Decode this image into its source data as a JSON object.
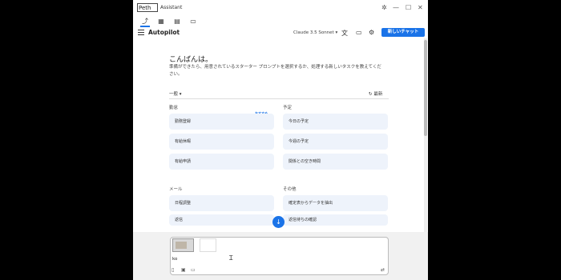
{
  "window": {
    "logo_text": "Peth",
    "app_title": "Assistant",
    "controls": {
      "settings": "✲",
      "minimize": "—",
      "maximize": "☐",
      "close": "✕"
    }
  },
  "tabs": [
    {
      "icon": "pin-icon",
      "glyph": "⤴",
      "active": true
    },
    {
      "icon": "grid-icon",
      "glyph": "▦",
      "active": false
    },
    {
      "icon": "panel-icon",
      "glyph": "▤",
      "active": false
    },
    {
      "icon": "folder-icon",
      "glyph": "▭",
      "active": false
    }
  ],
  "toolbar": {
    "title": "Autopilot",
    "model": "Claude 3.5 Sonnet ▾",
    "new_chat": "新しいチャット"
  },
  "main": {
    "greeting": "こんばんは。",
    "subtitle": "準備ができたら、用意されているスターター プロンプトを選択するか、処理する新しいタスクを教えてください。",
    "filter": "一般  ▾",
    "refresh": "↻ 最新",
    "badge": "おすすめ",
    "sections": {
      "left1": "勤怠",
      "right1": "予定",
      "left2": "メール",
      "right2": "その他"
    },
    "cards": {
      "left1": [
        "勤務登録",
        "有給休暇",
        "有給申請"
      ],
      "right1": [
        "今日の予定",
        "今週の予定",
        "関係との空き時間"
      ],
      "left2": [
        "日程調整",
        "返信"
      ],
      "right2": [
        "確定表からデータを抽出",
        "返信待ちの確認"
      ]
    }
  },
  "composer": {
    "text": "ko",
    "icons": [
      "attach-icon",
      "image-icon",
      "screen-icon",
      "send-settings-icon"
    ]
  }
}
